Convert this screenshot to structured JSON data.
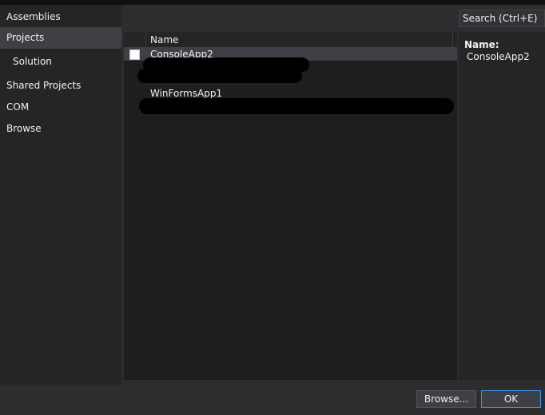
{
  "nav": {
    "assemblies": "Assemblies",
    "projects": "Projects",
    "solution": "Solution",
    "shared_projects": "Shared Projects",
    "com": "COM",
    "browse": "Browse"
  },
  "search": {
    "placeholder": "Search (Ctrl+E)"
  },
  "list": {
    "header_name": "Name",
    "rows": [
      {
        "label": "ConsoleApp2",
        "checked": false,
        "selected": true
      },
      {
        "label": "WinFormsApp1",
        "checked": false,
        "selected": false
      }
    ]
  },
  "details": {
    "name_label": "Name:",
    "name_value": "ConsoleApp2"
  },
  "footer": {
    "browse_label": "Browse...",
    "ok_label": "OK"
  },
  "colors": {
    "focus_border": "#3399ff",
    "selection": "#3f3f46",
    "panel": "#1e1e1e"
  }
}
